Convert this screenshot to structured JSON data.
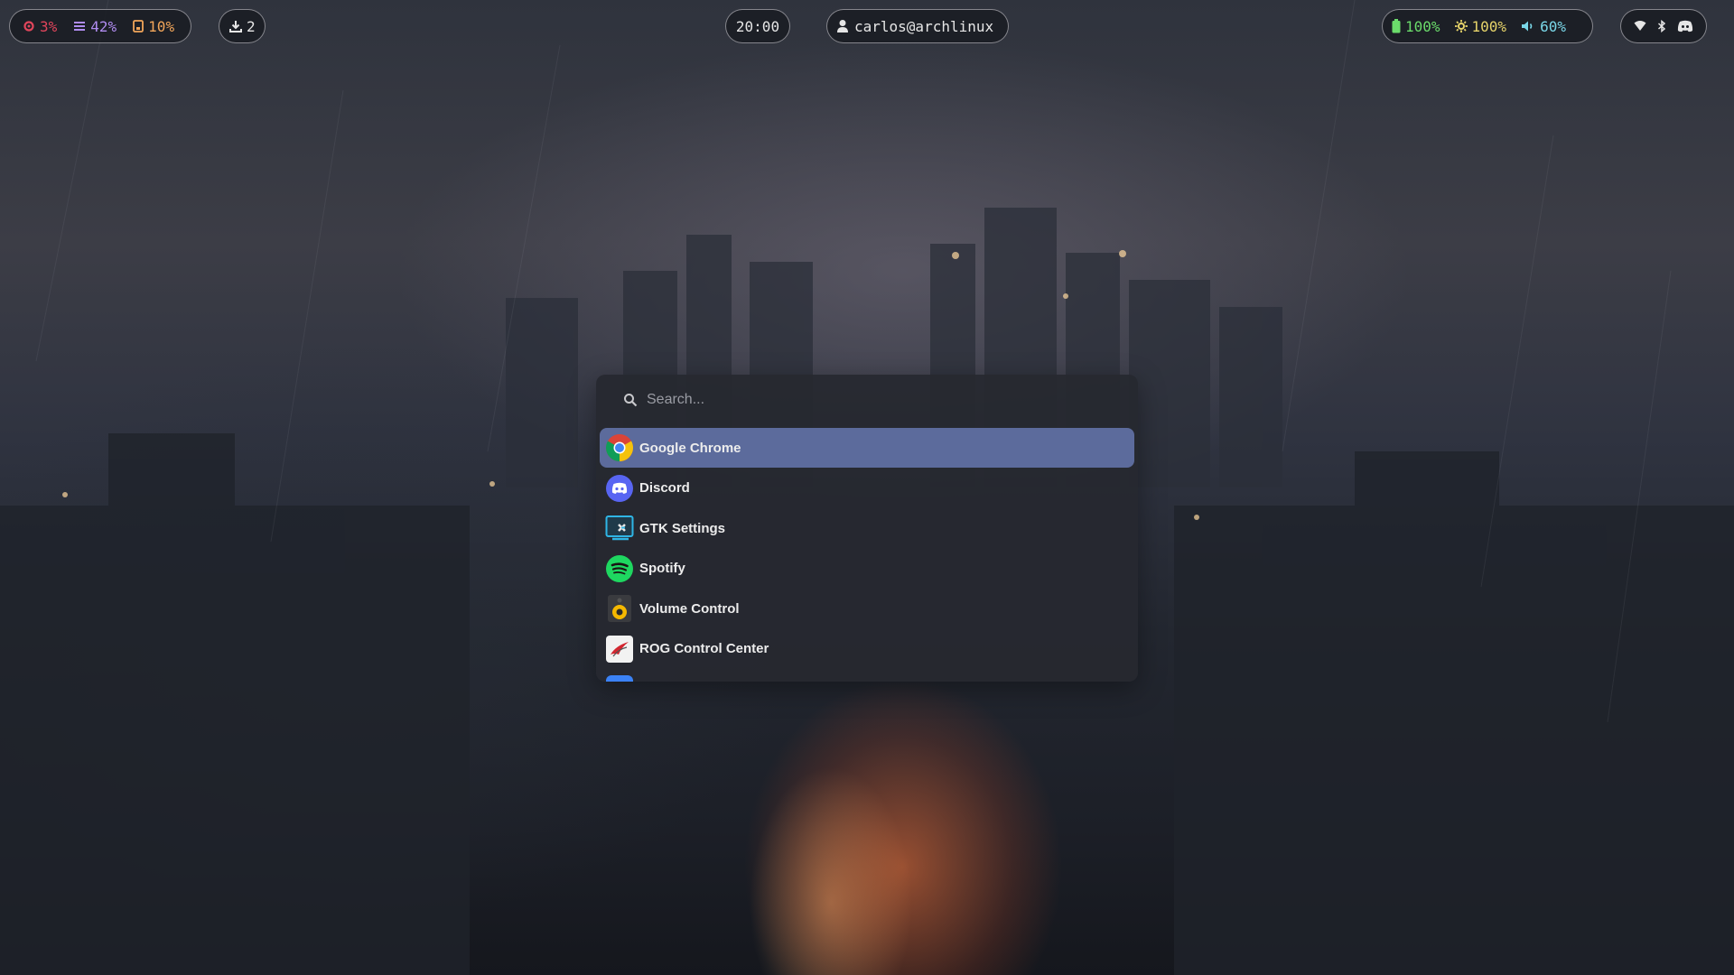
{
  "topbar": {
    "cpu": {
      "icon": "cpu-icon",
      "value": "3%",
      "color": "#e0455b"
    },
    "memory": {
      "icon": "memory-icon",
      "value": "42%",
      "color": "#b08cf0"
    },
    "disk": {
      "icon": "disk-icon",
      "value": "10%",
      "color": "#f2a65a"
    },
    "updates": {
      "icon": "download-icon",
      "value": "2"
    },
    "clock": "20:00",
    "user": {
      "icon": "user-icon",
      "label": "carlos@archlinux"
    },
    "battery": {
      "icon": "battery-icon",
      "value": "100%",
      "color": "#6bdc6b"
    },
    "brightness": {
      "icon": "brightness-icon",
      "value": "100%",
      "color": "#e7d46a"
    },
    "volume": {
      "icon": "volume-icon",
      "value": "60%",
      "color": "#7ad7e8"
    },
    "tray": [
      "wifi-icon",
      "bluetooth-icon",
      "discord-tray-icon"
    ]
  },
  "launcher": {
    "search_placeholder": "Search...",
    "search_value": "",
    "apps": [
      {
        "label": "Google Chrome",
        "icon": "chrome-icon",
        "selected": true
      },
      {
        "label": "Discord",
        "icon": "discord-icon",
        "selected": false
      },
      {
        "label": "GTK Settings",
        "icon": "gtk-settings-icon",
        "selected": false
      },
      {
        "label": "Spotify",
        "icon": "spotify-icon",
        "selected": false
      },
      {
        "label": "Volume Control",
        "icon": "volume-control-icon",
        "selected": false
      },
      {
        "label": "ROG Control Center",
        "icon": "rog-icon",
        "selected": false
      }
    ]
  },
  "colors": {
    "accent": "#5c6b9c",
    "panel": "#26282f"
  }
}
